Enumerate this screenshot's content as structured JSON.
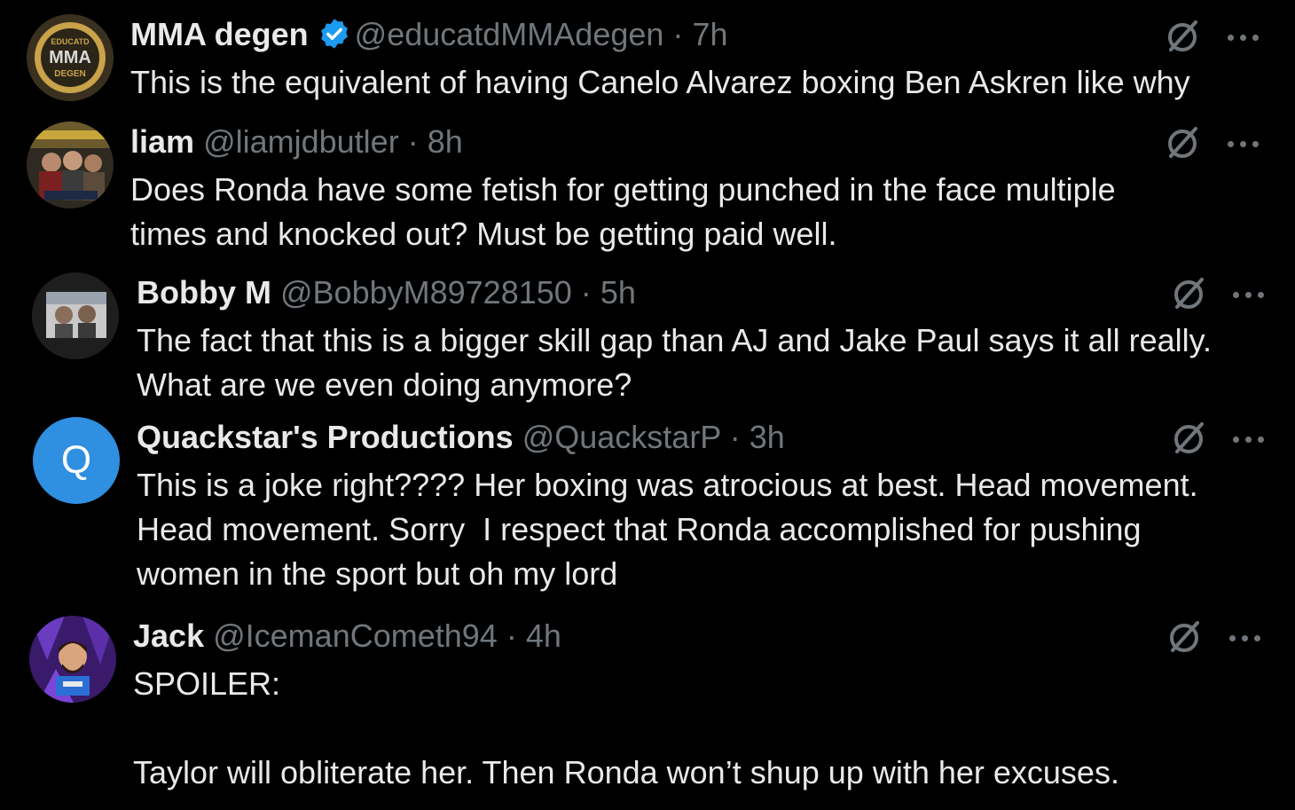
{
  "colors": {
    "background": "#000000",
    "text_primary": "#e7e9ea",
    "text_secondary": "#71767b",
    "verified_blue": "#1d9bf0"
  },
  "replies": [
    {
      "name": "MMA degen",
      "verified": true,
      "handle": "@educatdMMAdegen",
      "separator": "·",
      "time": "7h",
      "text": "This is the equivalent of having Canelo Alvarez boxing Ben Askren like why",
      "avatar": {
        "badge_lines": [
          "EDUCATD",
          "MMA",
          "DEGEN"
        ]
      }
    },
    {
      "name": "liam",
      "verified": false,
      "handle": "@liamjdbutler",
      "separator": "·",
      "time": "8h",
      "text": "Does Ronda have some fetish for getting punched in the face multiple\ntimes and knocked out? Must be getting paid well.",
      "avatar": {}
    },
    {
      "name": "Bobby M",
      "verified": false,
      "handle": "@BobbyM89728150",
      "separator": "·",
      "time": "5h",
      "text": "The fact that this is a bigger skill gap than AJ and Jake Paul says it all really.\nWhat are we even doing anymore?",
      "avatar": {}
    },
    {
      "name": "Quackstar's Productions",
      "verified": false,
      "handle": "@QuackstarP",
      "separator": "·",
      "time": "3h",
      "text": "This is a joke right???? Her boxing was atrocious at best. Head movement.\nHead movement. Sorry  I respect that Ronda accomplished for pushing\nwomen in the sport but oh my lord",
      "avatar": {
        "initial": "Q",
        "color": "#2f8fe0"
      }
    },
    {
      "name": "Jack",
      "verified": false,
      "handle": "@IcemanCometh94",
      "separator": "·",
      "time": "4h",
      "text": "SPOILER:\n\nTaylor will obliterate her. Then Ronda won’t shup up with her excuses.",
      "avatar": {}
    }
  ]
}
